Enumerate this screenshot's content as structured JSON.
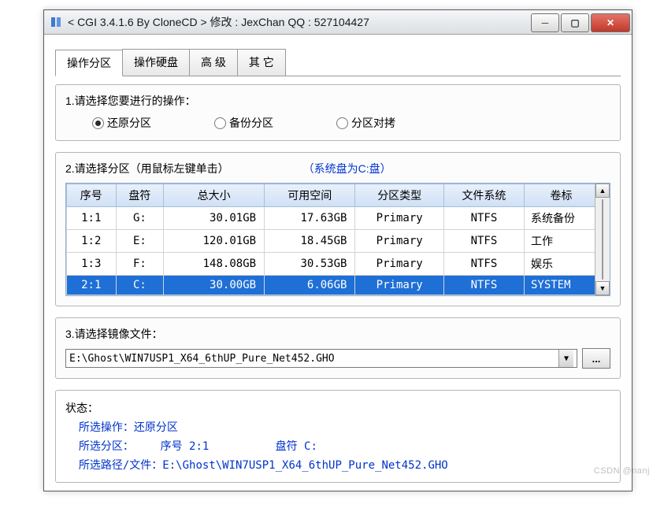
{
  "window": {
    "title": "< CGI 3.4.1.6 By CloneCD > 修改 : JexChan  QQ : 527104427"
  },
  "tabs": {
    "t0": "操作分区",
    "t1": "操作硬盘",
    "t2": "高 级",
    "t3": "其 它"
  },
  "section1": {
    "label": "1.请选择您要进行的操作：",
    "opt_restore": "还原分区",
    "opt_backup": "备份分区",
    "opt_clone": "分区对拷"
  },
  "section2": {
    "label": "2.请选择分区（用鼠标左键单击）",
    "hint": "（系统盘为C:盘）",
    "headers": {
      "h0": "序号",
      "h1": "盘符",
      "h2": "总大小",
      "h3": "可用空间",
      "h4": "分区类型",
      "h5": "文件系统",
      "h6": "卷标"
    },
    "rows": [
      {
        "idx": "1:1",
        "drv": "G:",
        "total": "30.01GB",
        "free": "17.63GB",
        "ptype": "Primary",
        "fs": "NTFS",
        "vol": "系统备份"
      },
      {
        "idx": "1:2",
        "drv": "E:",
        "total": "120.01GB",
        "free": "18.45GB",
        "ptype": "Primary",
        "fs": "NTFS",
        "vol": "工作"
      },
      {
        "idx": "1:3",
        "drv": "F:",
        "total": "148.08GB",
        "free": "30.53GB",
        "ptype": "Primary",
        "fs": "NTFS",
        "vol": "娱乐"
      },
      {
        "idx": "2:1",
        "drv": "C:",
        "total": "30.00GB",
        "free": "6.06GB",
        "ptype": "Primary",
        "fs": "NTFS",
        "vol": "SYSTEM"
      }
    ]
  },
  "section3": {
    "label": "3.请选择镜像文件：",
    "path": "E:\\Ghost\\WIN7USP1_X64_6thUP_Pure_Net452.GHO",
    "browse": "..."
  },
  "status": {
    "label": "状态：",
    "op_label": "所选操作：",
    "op_value": "还原分区",
    "part_label": "所选分区：",
    "part_idx_label": "序号",
    "part_idx_value": "2:1",
    "part_drv_label": "盘符",
    "part_drv_value": "C:",
    "path_label": "所选路径/文件：",
    "path_value": "E:\\Ghost\\WIN7USP1_X64_6thUP_Pure_Net452.GHO"
  },
  "watermark": "CSDN @nanj"
}
